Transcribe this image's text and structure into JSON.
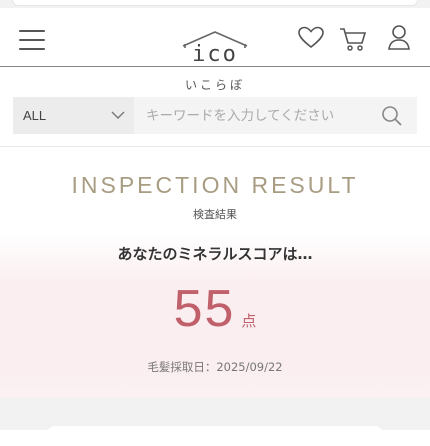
{
  "header": {
    "logo_text": "ico",
    "logo_sub": "いこらぼ"
  },
  "search": {
    "category_selected": "ALL",
    "placeholder": "キーワードを入力してください"
  },
  "result": {
    "title": "INSPECTION RESULT",
    "subtitle": "検査結果",
    "question": "あなたのミネラルスコアは…",
    "score": "55",
    "score_unit": "点",
    "date_text": "毛髪採取日：2025/09/22"
  },
  "colors": {
    "accent": "#c0606b",
    "title_gold": "#a89d83",
    "pink_bg": "#faeef0"
  }
}
